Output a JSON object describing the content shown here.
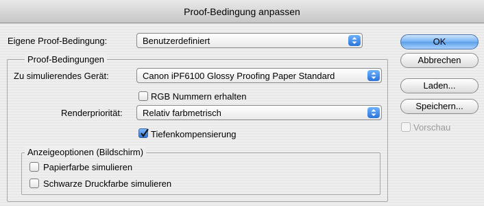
{
  "window": {
    "title": "Proof-Bedingung anpassen"
  },
  "custom_condition": {
    "label": "Eigene Proof-Bedingung:",
    "value": "Benutzerdefiniert"
  },
  "proof_group": {
    "legend": "Proof-Bedingungen",
    "device": {
      "label": "Zu simulierendes Gerät:",
      "value": "Canon iPF6100 Glossy Proofing Paper Standard"
    },
    "preserve_rgb": {
      "label": "RGB  Nummern erhalten",
      "checked": false
    },
    "intent": {
      "label": "Renderpriorität:",
      "value": "Relativ farbmetrisch"
    },
    "black_point": {
      "label": "Tiefenkompensierung",
      "checked": true
    }
  },
  "display_group": {
    "legend": "Anzeigeoptionen (Bildschirm)",
    "paper_color": {
      "label": "Papierfarbe simulieren",
      "checked": false
    },
    "black_ink": {
      "label": "Schwarze Druckfarbe simulieren",
      "checked": false
    }
  },
  "buttons": {
    "ok": "OK",
    "cancel": "Abbrechen",
    "load": "Laden...",
    "save": "Speichern...",
    "preview": {
      "label": "Vorschau",
      "checked": false,
      "enabled": false
    }
  },
  "colors": {
    "accent": "#5b9fe8",
    "window_bg": "#eeeeee",
    "desktop": "#a9b4c2"
  }
}
